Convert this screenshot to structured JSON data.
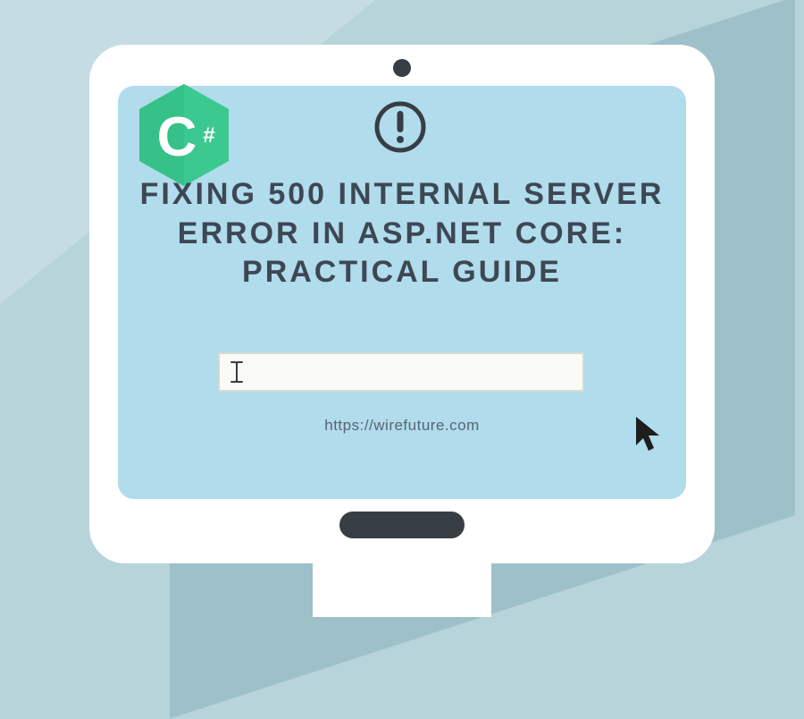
{
  "title": "FIXING 500 INTERNAL SERVER ERROR IN ASP.NET CORE: PRACTICAL GUIDE",
  "url": "https://wirefuture.com",
  "logo": {
    "letter": "C",
    "symbol": "#"
  },
  "colors": {
    "background": "#b8d4db",
    "screen": "#b0dcec",
    "frame": "#ffffff",
    "dark": "#373e43",
    "logo_primary": "#3cc98f",
    "logo_secondary": "#2db87e"
  }
}
